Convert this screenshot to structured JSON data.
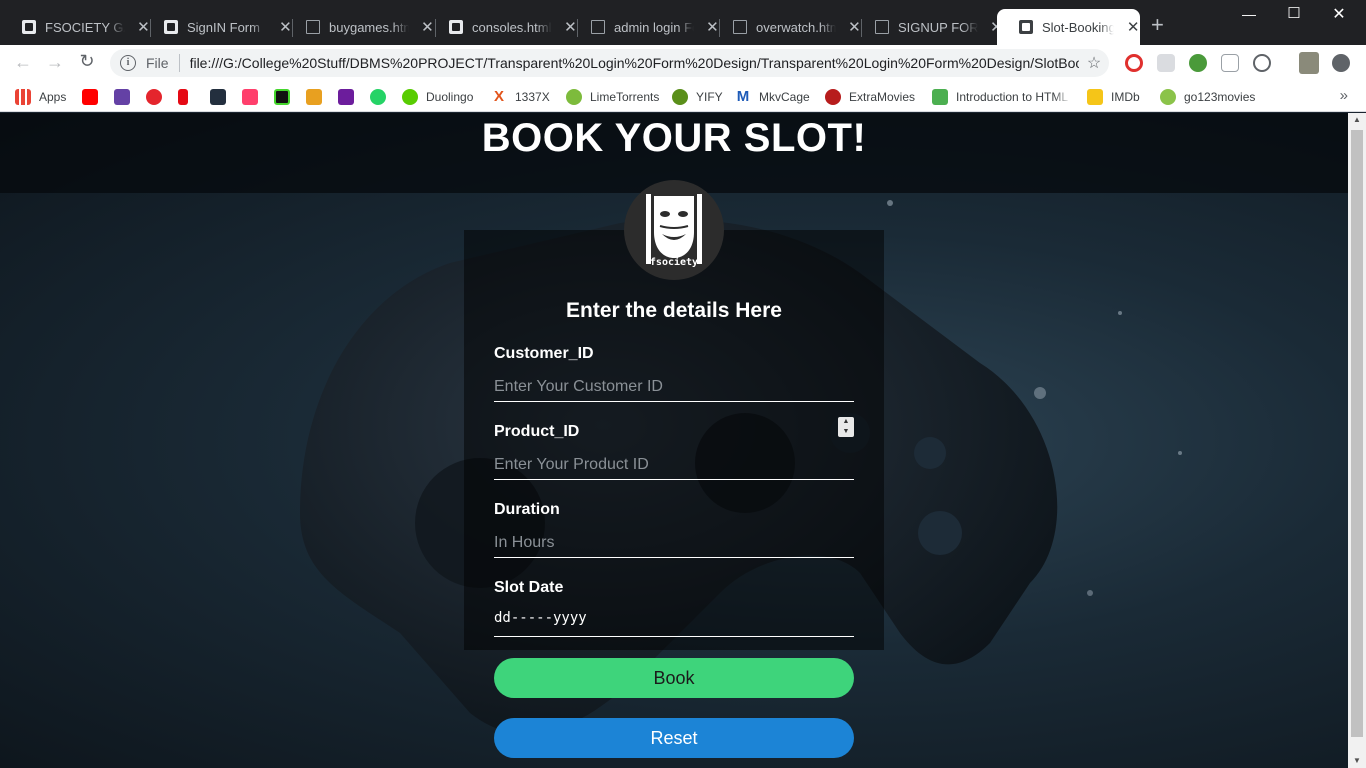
{
  "browser": {
    "tabs": [
      {
        "title": "FSOCIETY GAMES",
        "icon": "fsociety-icon"
      },
      {
        "title": "SignIN Form",
        "icon": "fsociety-icon"
      },
      {
        "title": "buygames.html",
        "icon": "document-icon"
      },
      {
        "title": "consoles.html",
        "icon": "fsociety-icon"
      },
      {
        "title": "admin login Form",
        "icon": "document-icon"
      },
      {
        "title": "overwatch.html",
        "icon": "document-icon"
      },
      {
        "title": "SIGNUP FORM",
        "icon": "document-icon"
      },
      {
        "title": "Slot-Booking Form",
        "icon": "fsociety-icon",
        "active": true
      }
    ],
    "address": {
      "scheme_label": "File",
      "url": "file:///G:/College%20Stuff/DBMS%20PROJECT/Transparent%20Login%20Form%20Design/Transparent%20Login%20Form%20Design/SlotBooki..."
    },
    "bookmarks": [
      {
        "label": "Apps",
        "icon": "apps-grid-icon"
      },
      {
        "label": "",
        "icon": "youtube-icon"
      },
      {
        "label": "",
        "icon": "twitch-icon"
      },
      {
        "label": "",
        "icon": "heart-icon"
      },
      {
        "label": "",
        "icon": "netflix-icon"
      },
      {
        "label": "",
        "icon": "amazon-icon"
      },
      {
        "label": "",
        "icon": "myntra-icon"
      },
      {
        "label": "",
        "icon": "razer-icon"
      },
      {
        "label": "",
        "icon": "game-icon"
      },
      {
        "label": "",
        "icon": "voot-icon"
      },
      {
        "label": "",
        "icon": "whatsapp-icon"
      },
      {
        "label": "Duolingo",
        "icon": "duolingo-icon"
      },
      {
        "label": "1337X",
        "icon": "1337x-icon"
      },
      {
        "label": "LimeTorrents",
        "icon": "limetorrents-icon"
      },
      {
        "label": "YIFY",
        "icon": "yify-icon"
      },
      {
        "label": "MkvCage",
        "icon": "mkvcage-icon"
      },
      {
        "label": "ExtraMovies",
        "icon": "extramovies-icon"
      },
      {
        "label": "Introduction to HTML",
        "icon": "w3-icon"
      },
      {
        "label": "IMDb",
        "icon": "imdb-icon"
      },
      {
        "label": "go123movies",
        "icon": "play-icon"
      }
    ],
    "colors": {
      "tabbar": "#202124",
      "toolbar": "#ffffff"
    }
  },
  "page": {
    "title": "BOOK YOUR SLOT!",
    "avatar_text": "fsociety",
    "form": {
      "heading": "Enter the details Here",
      "customer_id": {
        "label": "Customer_ID",
        "placeholder": "Enter Your Customer ID"
      },
      "product_id": {
        "label": "Product_ID",
        "placeholder": "Enter Your Product ID"
      },
      "duration": {
        "label": "Duration",
        "placeholder": "In Hours"
      },
      "slot_date": {
        "label": "Slot Date",
        "value": "dd-----yyyy"
      },
      "book_label": "Book",
      "reset_label": "Reset"
    },
    "colors": {
      "book": "#3ed47b",
      "reset": "#1c84d6"
    }
  }
}
